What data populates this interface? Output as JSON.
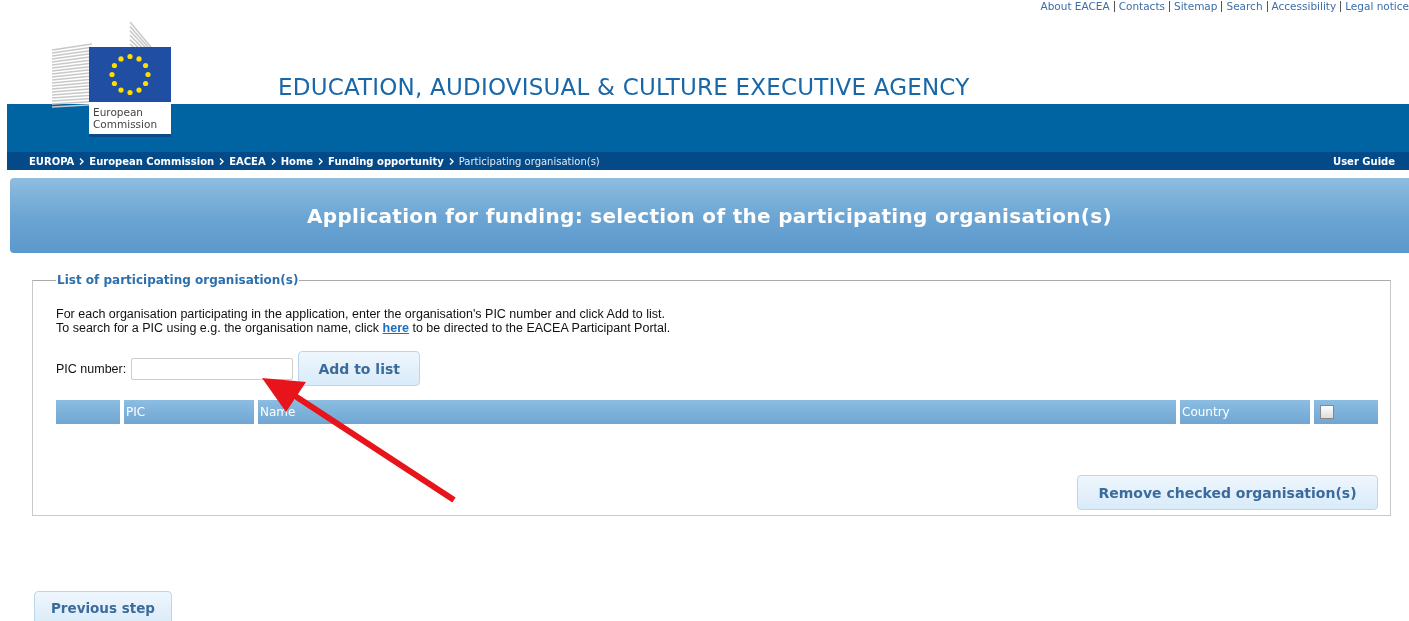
{
  "top_links": [
    "About EACEA",
    "Contacts",
    "Sitemap",
    "Search",
    "Accessibility",
    "Legal notice"
  ],
  "logo": {
    "caption_line1": "European",
    "caption_line2": "Commission"
  },
  "agency_title": "EDUCATION, AUDIOVISUAL & CULTURE EXECUTIVE AGENCY",
  "breadcrumb": [
    {
      "label": "EUROPA",
      "current": false
    },
    {
      "label": "European Commission",
      "current": false
    },
    {
      "label": "EACEA",
      "current": false
    },
    {
      "label": "Home",
      "current": false
    },
    {
      "label": "Funding opportunity",
      "current": false
    },
    {
      "label": "Participating organisation(s)",
      "current": true
    }
  ],
  "user_guide": "User Guide",
  "page_title": "Application for funding: selection of the participating organisation(s)",
  "fieldset": {
    "legend": "List of participating organisation(s)",
    "intro_line1": "For each organisation participating in the application, enter the organisation's PIC number and click Add to list.",
    "intro_line2_before": "To search for a PIC using e.g. the organisation name, click ",
    "intro_link": "here",
    "intro_line2_after": " to be directed to the EACEA Participant Portal.",
    "pic_label": "PIC number:",
    "add_button": "Add to list",
    "table": {
      "columns": [
        "PIC",
        "Name",
        "Country"
      ],
      "select_all_checked": false
    },
    "remove_button": "Remove checked organisation(s)"
  },
  "annotation_arrow": true,
  "previous_button": "Previous step"
}
